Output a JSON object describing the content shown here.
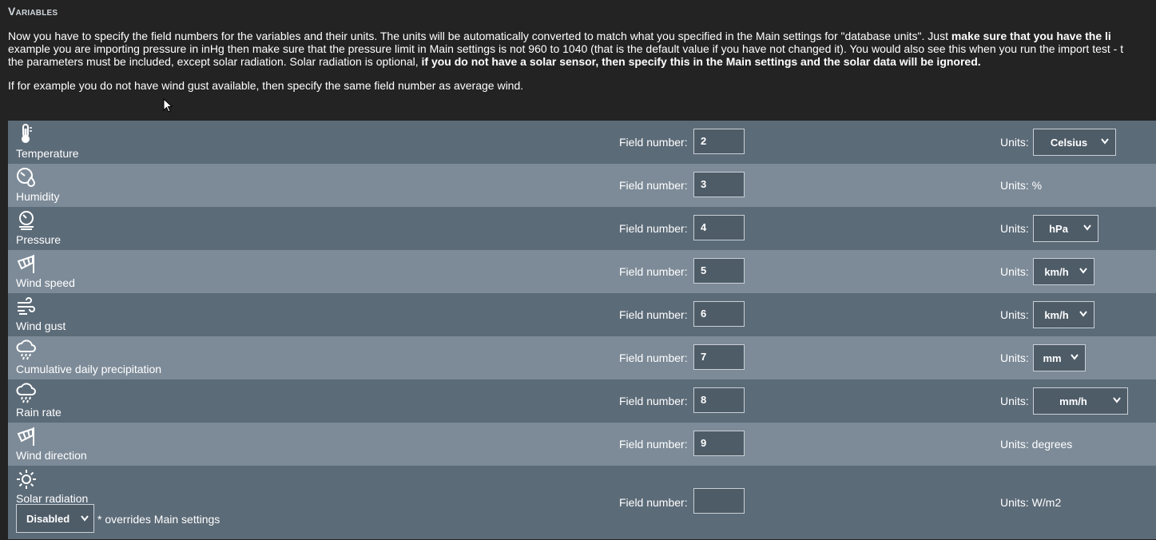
{
  "section_title": "Variables",
  "intro": {
    "line1_plain": "Now you have to specify the field numbers for the variables and their units. The units will be automatically converted to match what you specified in the Main settings for \"database units\". Just ",
    "line1_bold": "make sure that you have the li",
    "line2": "example you are importing pressure in inHg then make sure that the pressure limit in Main settings is not 960 to 1040 (that is the default value if you have not changed it). You would also see this when you run the import test - t",
    "line3_plain": "the parameters must be included, except solar radiation. Solar radiation is optional, ",
    "line3_bold": "if you do not have a solar sensor, then specify this in the Main settings and the solar data will be ignored."
  },
  "note": "If for example you do not have wind gust available, then specify the same field number as average wind.",
  "field_label": "Field number:",
  "units_label": "Units:",
  "variables": [
    {
      "name": "Temperature",
      "icon": "thermometer-icon",
      "field": "2",
      "units_select": "Celsius",
      "units_text": ""
    },
    {
      "name": "Humidity",
      "icon": "humidity-gauge-icon",
      "field": "3",
      "units_select": "",
      "units_text": "Units: %"
    },
    {
      "name": "Pressure",
      "icon": "barometer-icon",
      "field": "4",
      "units_select": "hPa",
      "units_text": ""
    },
    {
      "name": "Wind speed",
      "icon": "windsock-icon",
      "field": "5",
      "units_select": "km/h",
      "units_text": ""
    },
    {
      "name": "Wind gust",
      "icon": "wind-icon",
      "field": "6",
      "units_select": "km/h",
      "units_text": ""
    },
    {
      "name": "Cumulative daily precipitation",
      "icon": "rain-cloud-icon",
      "field": "7",
      "units_select": "mm",
      "units_text": ""
    },
    {
      "name": "Rain rate",
      "icon": "rain-cloud-icon",
      "field": "8",
      "units_select": "mm/h",
      "units_text": ""
    },
    {
      "name": "Wind direction",
      "icon": "windsock-icon",
      "field": "9",
      "units_select": "",
      "units_text": "Units: degrees"
    },
    {
      "name": "Solar radiation",
      "icon": "sun-icon",
      "field": "",
      "units_select": "",
      "units_text": "Units: W/m2"
    }
  ],
  "solar_mode": {
    "selected": "Disabled",
    "note": "* overrides Main settings"
  },
  "colors": {
    "row_dark": "#5c6b78",
    "row_light": "#7d8b98",
    "background": "#232323"
  }
}
